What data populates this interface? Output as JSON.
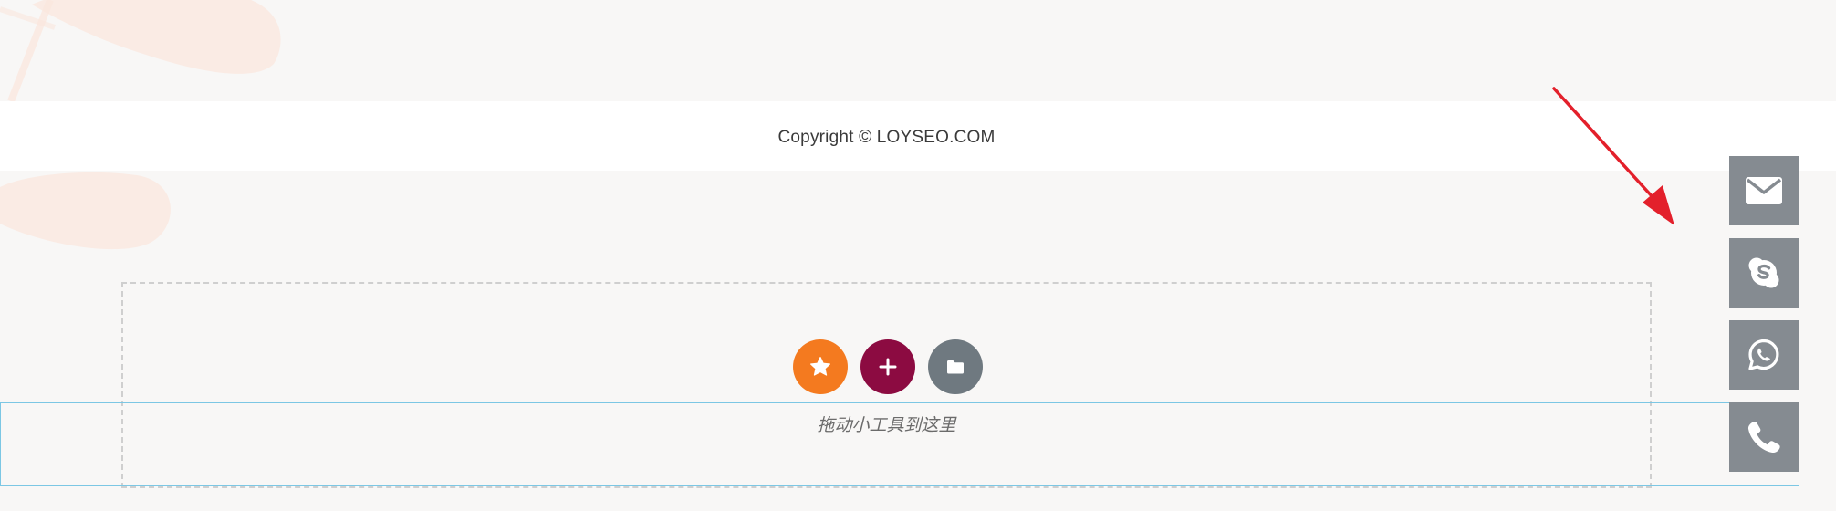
{
  "footer": {
    "copyright": "Copyright © LOYSEO.COM"
  },
  "widget_area": {
    "hint": "拖动小工具到这里",
    "buttons": [
      {
        "icon": "star-icon",
        "color": "#f47a1f"
      },
      {
        "icon": "plus-icon",
        "color": "#8c0b41"
      },
      {
        "icon": "folder-icon",
        "color": "#6f7980"
      }
    ]
  },
  "floating_contact": {
    "color": "#858b91",
    "buttons": [
      {
        "icon": "email-icon"
      },
      {
        "icon": "skype-icon"
      },
      {
        "icon": "whatsapp-icon"
      },
      {
        "icon": "phone-icon"
      }
    ]
  },
  "annotation": {
    "arrow_color": "#e3202b"
  },
  "colors": {
    "page_background": "#f8f7f6",
    "decor_leaf": "#fbe7de",
    "selection_outline": "#7cc7e4",
    "dashed_border": "#cfcfcf"
  }
}
